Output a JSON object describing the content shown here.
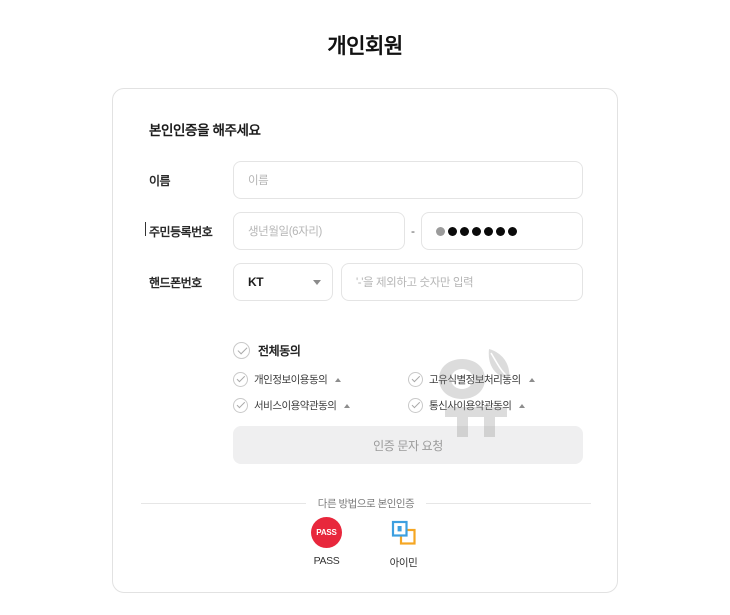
{
  "page": {
    "title": "개인회원"
  },
  "card": {
    "heading": "본인인증을 해주세요"
  },
  "form": {
    "name": {
      "label": "이름",
      "placeholder": "이름",
      "value": ""
    },
    "rrn": {
      "label": "주민등록번호",
      "birth_placeholder": "생년월일(6자리)",
      "birth_value": "",
      "separator": "-",
      "masked_value": "•••••••",
      "masked_digit_count": 7
    },
    "phone": {
      "label": "핸드폰번호",
      "carrier_selected": "KT",
      "carrier_caret_icon": "caret-down-icon",
      "placeholder": "'-'을 제외하고 숫자만 입력",
      "value": ""
    }
  },
  "agreements": {
    "all": {
      "label": "전체동의",
      "check_icon": "check-circle-icon"
    },
    "items": [
      {
        "label": "개인정보이용동의",
        "check_icon": "check-circle-icon",
        "expand_icon": "chevron-up-icon"
      },
      {
        "label": "고유식별정보처리동의",
        "check_icon": "check-circle-icon",
        "expand_icon": "chevron-up-icon"
      },
      {
        "label": "서비스이용약관동의",
        "check_icon": "check-circle-icon",
        "expand_icon": "chevron-up-icon"
      },
      {
        "label": "통신사이용약관동의",
        "check_icon": "check-circle-icon",
        "expand_icon": "chevron-up-icon"
      }
    ]
  },
  "submit": {
    "label": "인증 문자 요청"
  },
  "alternatives": {
    "divider_label": "다른 방법으로 본인인증",
    "methods": [
      {
        "name": "PASS",
        "badge_text": "PASS",
        "icon": "pass-badge-icon"
      },
      {
        "name": "아이민",
        "icon": "ipin-icon"
      }
    ]
  },
  "colors": {
    "pass_red": "#e8273c",
    "ipin_blue": "#3d9fe0",
    "ipin_orange": "#f5a623",
    "border": "#e2e2e2",
    "disabled_button": "#efeff0"
  }
}
